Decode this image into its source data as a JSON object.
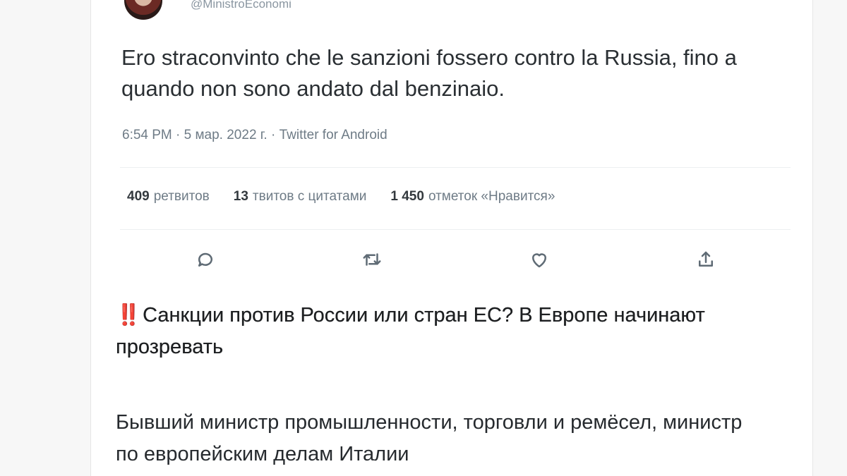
{
  "tweet": {
    "handle": "@MinistroEconomi",
    "text": "Ero straconvinto che le sanzioni fossero contro la Russia, fino a quando non sono andato dal benzinaio.",
    "meta": "6:54 PM · 5 мар. 2022 г. · Twitter for Android",
    "stats": {
      "retweets_count": "409",
      "retweets_label": "ретвитов",
      "quotes_count": "13",
      "quotes_label": "твитов с цитатами",
      "likes_count": "1 450",
      "likes_label": "отметок «Нравится»"
    },
    "actions": {
      "reply_icon": "reply-icon",
      "retweet_icon": "retweet-icon",
      "like_icon": "heart-icon",
      "share_icon": "share-icon"
    }
  },
  "article": {
    "headline_emoji": "‼️",
    "headline": "Санкции против России или стран ЕС? В Европе начинают прозревать",
    "body": "Бывший министр промышленности, торговли и ремёсел, министр по европейским делам Италии"
  }
}
